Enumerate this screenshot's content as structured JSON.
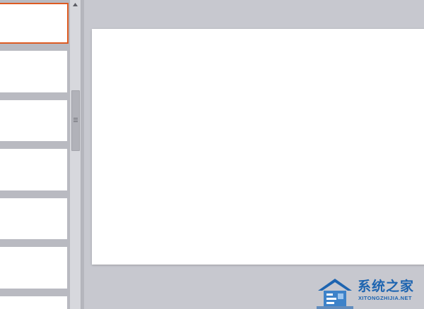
{
  "thumbnails": {
    "count": 7,
    "selected_index": 0
  },
  "scrollbar": {
    "icons": {
      "up": "triangle-up-icon",
      "grip": "grip-lines-icon"
    }
  },
  "watermark": {
    "title": "系统之家",
    "subtitle": "XITONGZHIJIA.NET",
    "logo_icon": "house-logo-icon"
  },
  "colors": {
    "selection_border": "#dd5a22",
    "panel_bg": "#b9bac1",
    "workspace_bg": "#c7c8cf",
    "watermark_blue": "#1d64b0"
  }
}
